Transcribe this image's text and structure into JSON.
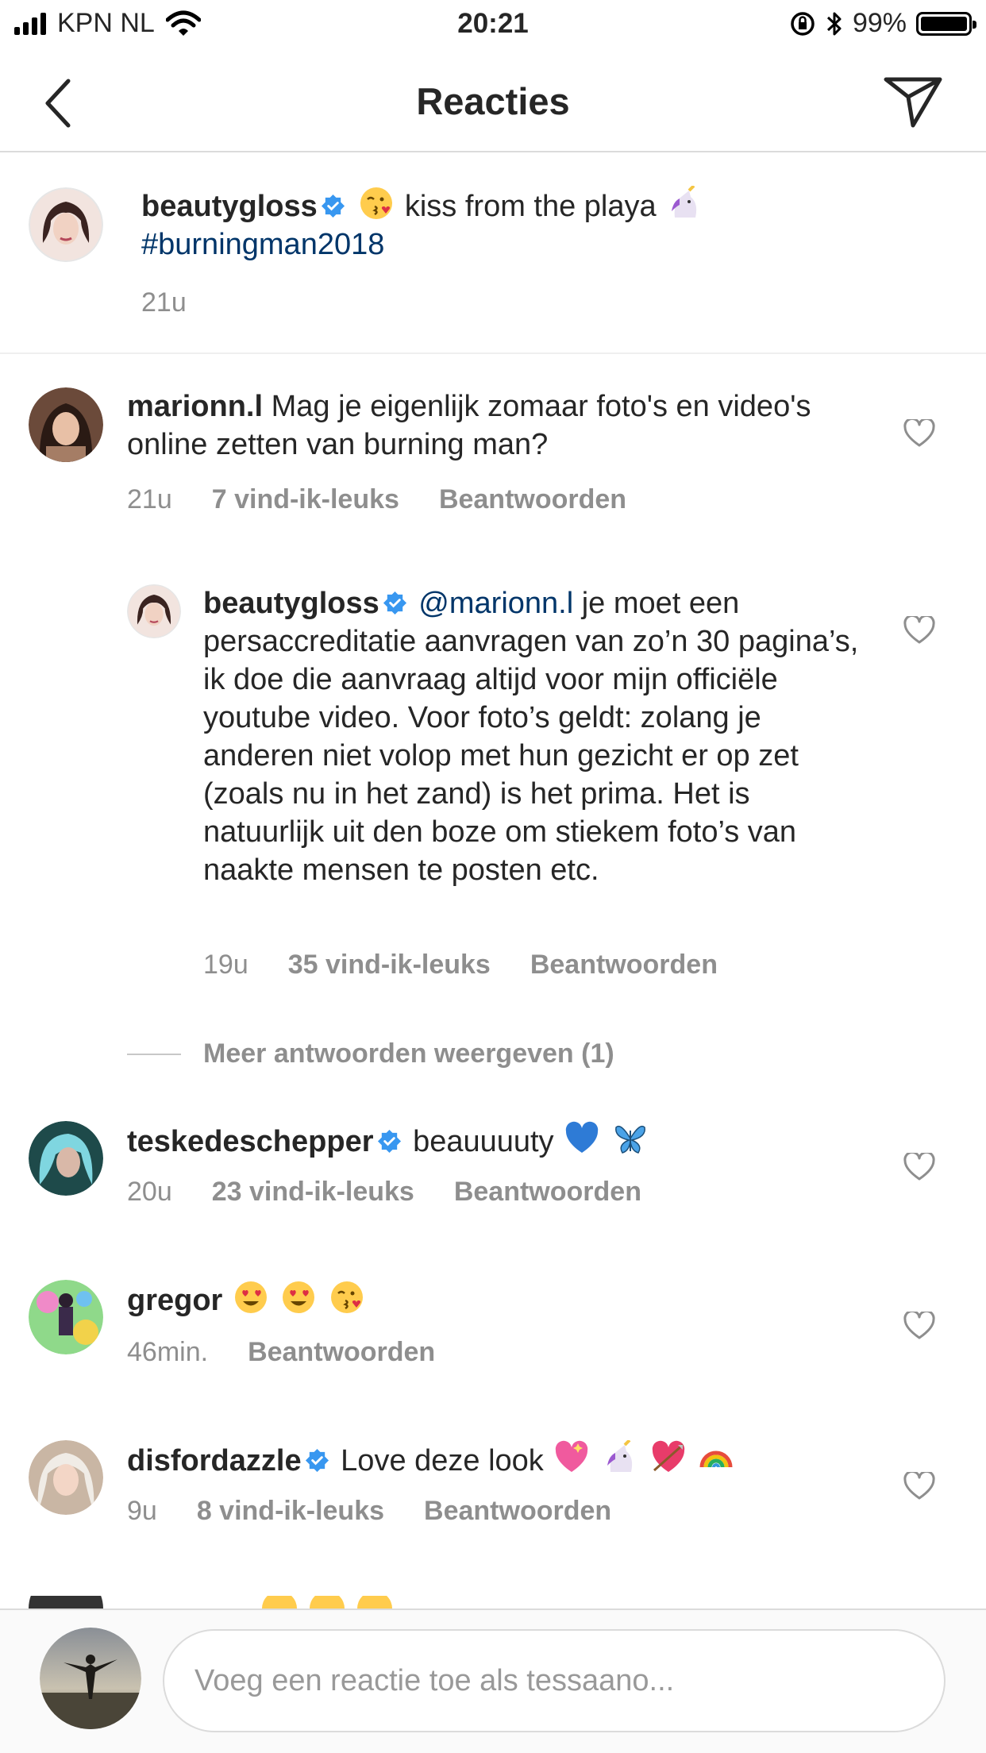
{
  "status_bar": {
    "carrier": "KPN NL",
    "time": "20:21",
    "battery": "99%"
  },
  "nav": {
    "title": "Reacties"
  },
  "caption": {
    "username": "beautygloss",
    "text": "kiss from the playa",
    "hashtag": "#burningman2018",
    "time": "21u"
  },
  "comments": [
    {
      "username": "marionn.l",
      "text": "Mag je eigenlijk zomaar foto's en video's online zetten van burning man?",
      "time": "21u",
      "likes": "7 vind-ik-leuks",
      "reply_label": "Beantwoorden"
    },
    {
      "username": "beautygloss",
      "mention": "@marionn.l",
      "text": "je moet een persaccreditatie aanvragen van zo’n 30 pagina’s, ik doe die aanvraag altijd voor mijn officiële youtube video. Voor foto’s geldt: zolang je anderen niet volop met hun gezicht er op zet (zoals nu in het zand) is het prima. Het is natuurlijk uit den boze om stiekem foto’s van naakte mensen te posten etc.",
      "time": "19u",
      "likes": "35 vind-ik-leuks",
      "reply_label": "Beantwoorden"
    },
    {
      "username": "teskedeschepper",
      "text": "beauuuuty",
      "time": "20u",
      "likes": "23 vind-ik-leuks",
      "reply_label": "Beantwoorden"
    },
    {
      "username": "gregor",
      "text": "",
      "time": "46min.",
      "reply_label": "Beantwoorden"
    },
    {
      "username": "disfordazzle",
      "text": "Love deze look",
      "time": "9u",
      "likes": "8 vind-ik-leuks",
      "reply_label": "Beantwoorden"
    }
  ],
  "more_replies": "Meer antwoorden weergeven (1)",
  "input": {
    "placeholder": "Voeg een reactie toe als tessaano..."
  },
  "colors": {
    "link": "#003569",
    "meta": "#8e8e8e",
    "verified": "#3897f0",
    "text": "#262626"
  },
  "icons": [
    "back-icon",
    "send-icon",
    "verified-badge-icon",
    "heart-icon",
    "kissing-face-emoji",
    "unicorn-emoji",
    "blue-heart-emoji",
    "butterfly-emoji",
    "heart-eyes-emoji",
    "sparkling-heart-emoji",
    "heart-arrow-emoji",
    "rainbow-emoji"
  ]
}
